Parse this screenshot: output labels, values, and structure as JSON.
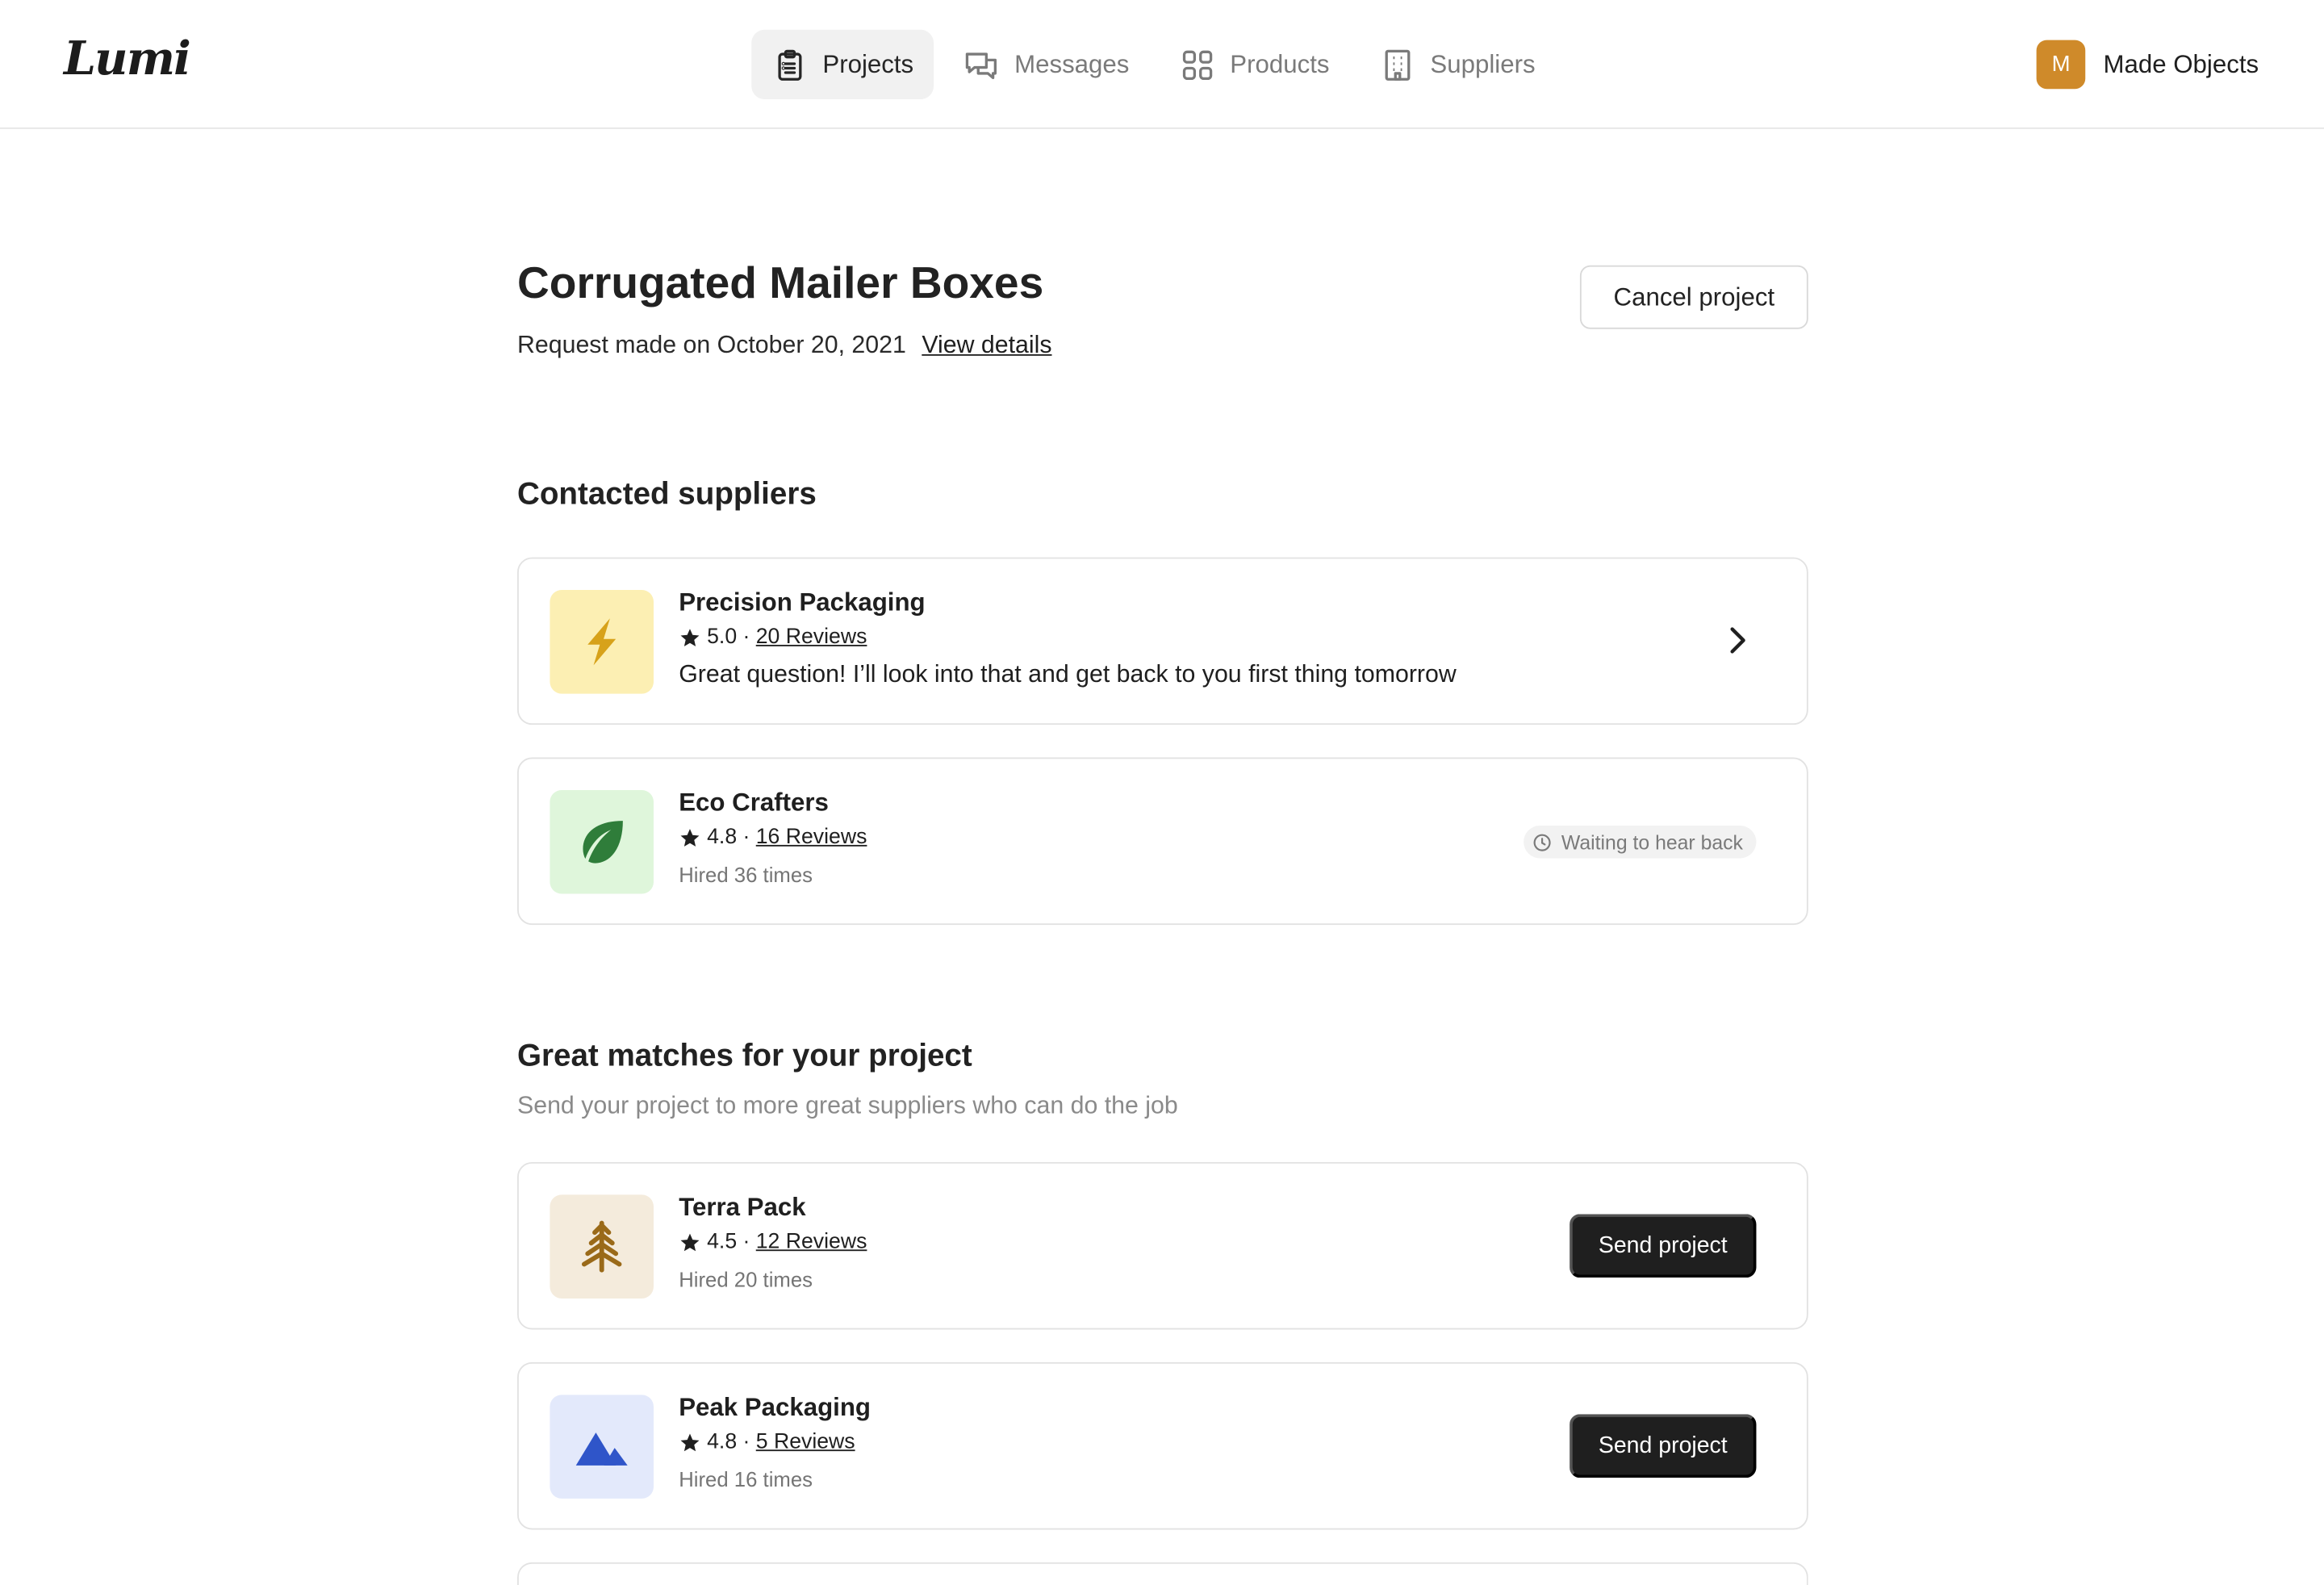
{
  "brand": {
    "logo_text": "Lumi"
  },
  "nav": {
    "items": [
      {
        "label": "Projects",
        "icon": "clipboard-icon",
        "active": true
      },
      {
        "label": "Messages",
        "icon": "chat-bubbles-icon",
        "active": false
      },
      {
        "label": "Products",
        "icon": "grid-icon",
        "active": false
      },
      {
        "label": "Suppliers",
        "icon": "building-icon",
        "active": false
      }
    ]
  },
  "account": {
    "avatar_initial": "M",
    "name": "Made Objects",
    "avatar_color": "#cf8a2a"
  },
  "project": {
    "title": "Corrugated Mailer Boxes",
    "request_text": "Request made on October 20, 2021",
    "view_details_label": "View details",
    "cancel_label": "Cancel project"
  },
  "contacted": {
    "heading": "Contacted suppliers",
    "suppliers": [
      {
        "name": "Precision Packaging",
        "rating": "5.0",
        "separator": "·",
        "reviews": "20 Reviews",
        "message": "Great question! I’ll look into that and get back to you first thing tomorrow",
        "icon": "lightning-icon",
        "icon_bg": "#fcefb3",
        "icon_color": "#d7a21a"
      },
      {
        "name": "Eco Crafters",
        "rating": "4.8",
        "separator": "·",
        "reviews": "16 Reviews",
        "meta": "Hired 36 times",
        "status": "Waiting to hear back",
        "icon": "leaf-icon",
        "icon_bg": "#dff6db",
        "icon_color": "#2f7d3a"
      }
    ]
  },
  "matches": {
    "heading": "Great matches for your project",
    "subheading": "Send your project to more great suppliers who can do the job",
    "suppliers": [
      {
        "name": "Terra Pack",
        "rating": "4.5",
        "separator": "·",
        "reviews": "12 Reviews",
        "meta": "Hired 20 times",
        "button": "Send project",
        "icon": "pine-tree-icon",
        "icon_bg": "#f4ebdc",
        "icon_color": "#9a6a19"
      },
      {
        "name": "Peak Packaging",
        "rating": "4.8",
        "separator": "·",
        "reviews": "5 Reviews",
        "meta": "Hired 16 times",
        "button": "Send project",
        "icon": "mountains-icon",
        "icon_bg": "#e3e9fb",
        "icon_color": "#2f55c9"
      }
    ]
  }
}
